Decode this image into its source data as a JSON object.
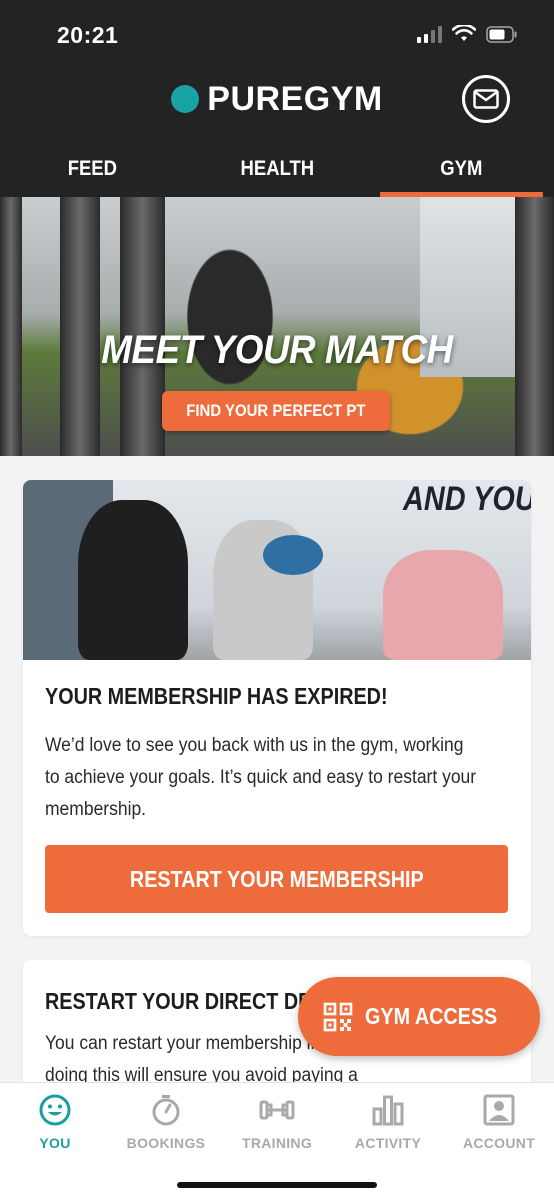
{
  "status_bar": {
    "time": "20:21"
  },
  "brand": {
    "name": "PUREGYM",
    "dot_color": "#1aa3a5"
  },
  "tabs": [
    {
      "label": "FEED",
      "active": false
    },
    {
      "label": "HEALTH",
      "active": false
    },
    {
      "label": "GYM",
      "active": true
    }
  ],
  "hero": {
    "title": "MEET YOUR MATCH",
    "button_label": "FIND YOUR PERFECT PT"
  },
  "membership_card": {
    "image_text": "AND YOU W",
    "title": "YOUR MEMBERSHIP HAS EXPIRED!",
    "body": "We’d love to see you back with us in the gym, working to achieve your goals. It’s quick and easy to restart your membership.",
    "button_label": "RESTART YOUR MEMBERSHIP"
  },
  "direct_debit_card": {
    "title": "RESTART YOUR DIRECT DEBIT",
    "body": "You can restart your membership in a few simple steps: doing this will ensure you avoid paying a"
  },
  "gym_access": {
    "label": "GYM ACCESS",
    "icon": "qr-code-icon"
  },
  "bottom_nav": [
    {
      "label": "YOU",
      "icon": "smiley-icon",
      "active": true
    },
    {
      "label": "BOOKINGS",
      "icon": "stopwatch-icon",
      "active": false
    },
    {
      "label": "TRAINING",
      "icon": "dumbbell-icon",
      "active": false
    },
    {
      "label": "ACTIVITY",
      "icon": "bar-chart-icon",
      "active": false
    },
    {
      "label": "ACCOUNT",
      "icon": "account-icon",
      "active": false
    }
  ],
  "colors": {
    "accent": "#ee6b3b",
    "brand_teal": "#1aa3a5",
    "header_bg": "#232323"
  }
}
